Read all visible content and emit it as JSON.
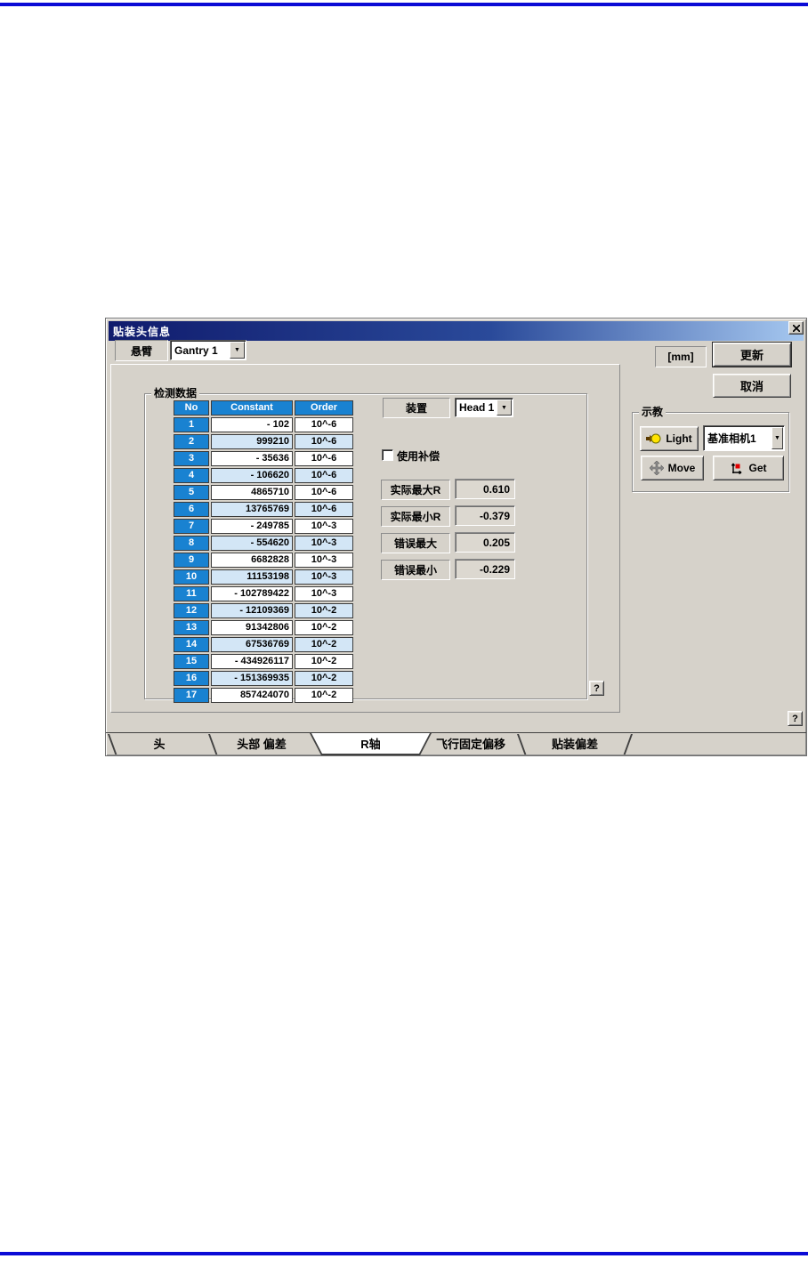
{
  "dialog": {
    "title": "贴装头信息",
    "gantry": {
      "label": "悬臂",
      "value": "Gantry 1"
    },
    "unit_label": "[mm]",
    "update_button": "更新",
    "cancel_button": "取消",
    "data_group": {
      "title": "检测数据",
      "table": {
        "headers": [
          "No",
          "Constant",
          "Order"
        ],
        "rows": [
          [
            "1",
            "- 102",
            "10^-6"
          ],
          [
            "2",
            "999210",
            "10^-6"
          ],
          [
            "3",
            "- 35636",
            "10^-6"
          ],
          [
            "4",
            "- 106620",
            "10^-6"
          ],
          [
            "5",
            "4865710",
            "10^-6"
          ],
          [
            "6",
            "13765769",
            "10^-6"
          ],
          [
            "7",
            "- 249785",
            "10^-3"
          ],
          [
            "8",
            "- 554620",
            "10^-3"
          ],
          [
            "9",
            "6682828",
            "10^-3"
          ],
          [
            "10",
            "11153198",
            "10^-3"
          ],
          [
            "11",
            "- 102789422",
            "10^-3"
          ],
          [
            "12",
            "- 12109369",
            "10^-2"
          ],
          [
            "13",
            "91342806",
            "10^-2"
          ],
          [
            "14",
            "67536769",
            "10^-2"
          ],
          [
            "15",
            "- 434926117",
            "10^-2"
          ],
          [
            "16",
            "- 151369935",
            "10^-2"
          ],
          [
            "17",
            "857424070",
            "10^-2"
          ]
        ]
      },
      "device": {
        "label": "装置",
        "value": "Head 1"
      },
      "compensation_label": "使用补偿",
      "fields": [
        {
          "label": "实际最大R",
          "value": "0.610"
        },
        {
          "label": "实际最小R",
          "value": "-0.379"
        },
        {
          "label": "错误最大",
          "value": "0.205"
        },
        {
          "label": "错误最小",
          "value": "-0.229"
        }
      ],
      "help_button": "?"
    },
    "teach_group": {
      "title": "示教",
      "light_button": "Light",
      "camera_select": "基准相机1",
      "move_button": "Move",
      "get_button": "Get"
    },
    "help_button": "?",
    "tabs": [
      {
        "label": "头",
        "active": false
      },
      {
        "label": "头部 偏差",
        "active": false
      },
      {
        "label": "R轴",
        "active": true
      },
      {
        "label": "飞行固定偏移",
        "active": false
      },
      {
        "label": "贴装偏差",
        "active": false
      }
    ]
  },
  "colors": {
    "dialog_bg": "#d6d2ca",
    "titlebar_start": "#101b6d",
    "titlebar_end": "#a6c8f0",
    "table_header_bg": "#1982d1",
    "table_alt_row_bg": "#d3e6f6",
    "page_rule_blue": "#0b0bd6"
  }
}
